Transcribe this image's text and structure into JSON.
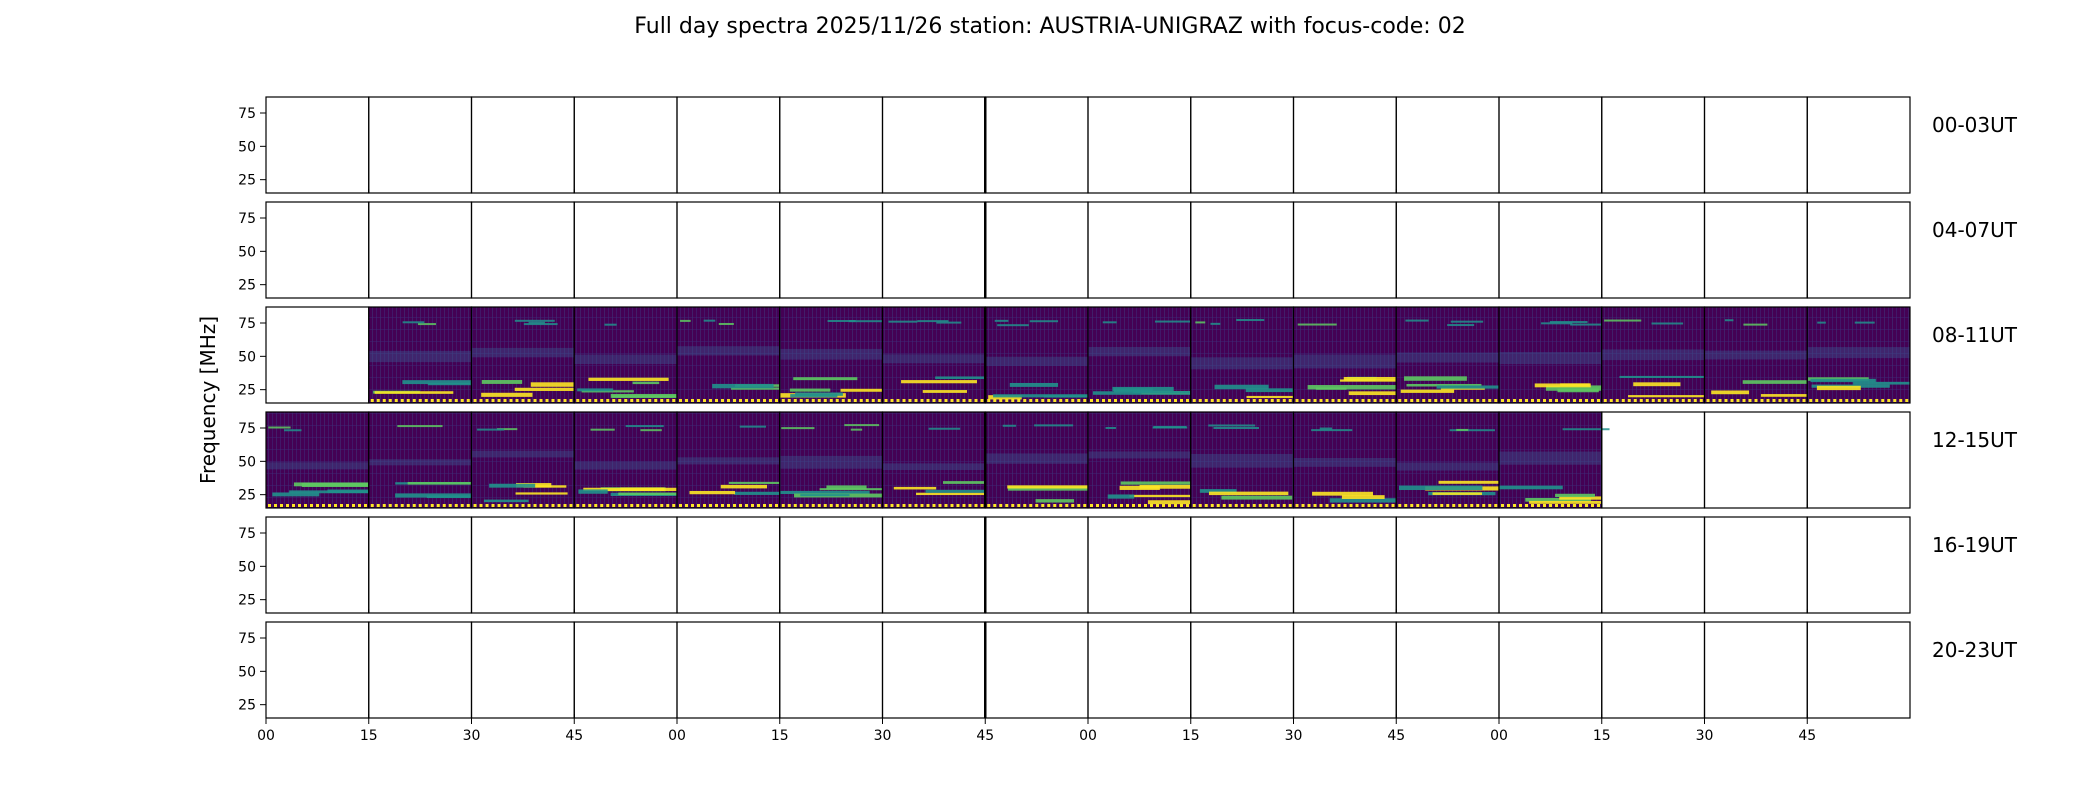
{
  "chart_data": {
    "type": "heatmap",
    "title": "Full day spectra 2025/11/26 station: AUSTRIA-UNIGRAZ with focus-code: 02",
    "ylabel": "Frequency [MHz]",
    "xlabel": "",
    "colormap": "viridis",
    "colors": {
      "low": "#440154",
      "mid": "#21918c",
      "high": "#fde725"
    },
    "y_ticks": [
      "75",
      "50",
      "25"
    ],
    "y_range_mhz": [
      15,
      87
    ],
    "x_tick_labels": [
      "00",
      "15",
      "30",
      "45",
      "00",
      "15",
      "30",
      "45",
      "00",
      "15",
      "30",
      "45",
      "00",
      "15",
      "30",
      "45"
    ],
    "panels_per_row": 16,
    "panel_duration_min": 15,
    "rows": [
      {
        "label": "00-03UT",
        "data_present": [
          0,
          0,
          0,
          0,
          0,
          0,
          0,
          0,
          0,
          0,
          0,
          0,
          0,
          0,
          0,
          0
        ]
      },
      {
        "label": "04-07UT",
        "data_present": [
          0,
          0,
          0,
          0,
          0,
          0,
          0,
          0,
          0,
          0,
          0,
          0,
          0,
          0,
          0,
          0
        ]
      },
      {
        "label": "08-11UT",
        "data_present": [
          0,
          1,
          1,
          1,
          1,
          1,
          1,
          1,
          1,
          1,
          1,
          1,
          1,
          1,
          1,
          1
        ]
      },
      {
        "label": "12-15UT",
        "data_present": [
          1,
          1,
          1,
          1,
          1,
          1,
          1,
          1,
          1,
          1,
          1,
          1,
          1,
          0,
          0,
          0
        ]
      },
      {
        "label": "16-19UT",
        "data_present": [
          0,
          0,
          0,
          0,
          0,
          0,
          0,
          0,
          0,
          0,
          0,
          0,
          0,
          0,
          0,
          0
        ]
      },
      {
        "label": "20-23UT",
        "data_present": [
          0,
          0,
          0,
          0,
          0,
          0,
          0,
          0,
          0,
          0,
          0,
          0,
          0,
          0,
          0,
          0
        ]
      }
    ],
    "grid": false,
    "legend": "none"
  }
}
